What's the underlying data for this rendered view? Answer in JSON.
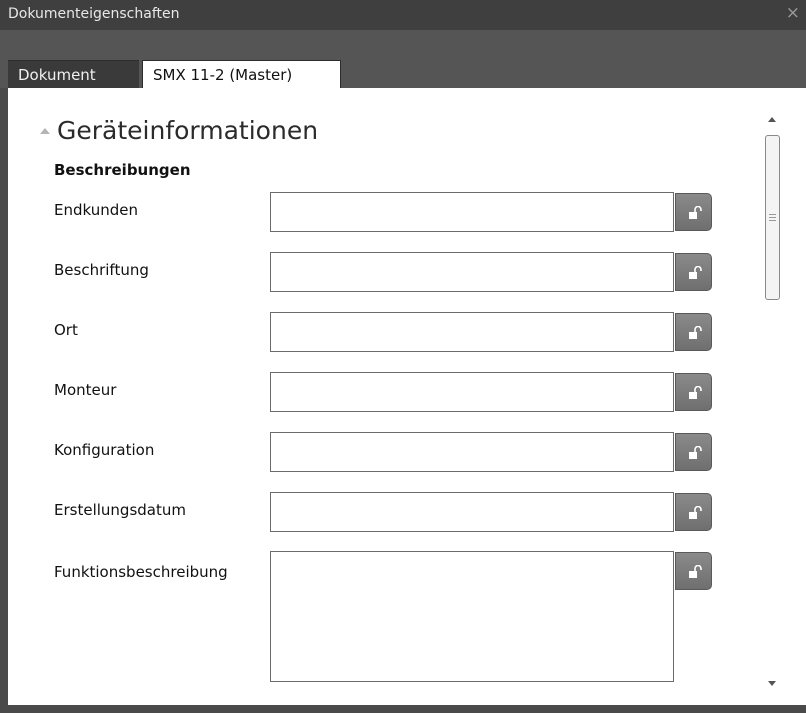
{
  "window": {
    "title": "Dokumenteigenschaften",
    "close_glyph": "×"
  },
  "tabs": [
    {
      "label": "Dokument",
      "active": false
    },
    {
      "label": "SMX 11-2 (Master)",
      "active": true
    }
  ],
  "section": {
    "title": "Geräteinformationen",
    "subheading": "Beschreibungen",
    "fields": [
      {
        "label": "Endkunden",
        "value": ""
      },
      {
        "label": "Beschriftung",
        "value": ""
      },
      {
        "label": "Ort",
        "value": ""
      },
      {
        "label": "Monteur",
        "value": ""
      },
      {
        "label": "Konfiguration",
        "value": ""
      },
      {
        "label": "Erstellungsdatum",
        "value": ""
      },
      {
        "label": "Funktionsbeschreibung",
        "value": ""
      }
    ]
  },
  "icons": {
    "collapse": "triangle-up-icon",
    "lock": "unlocked-padlock-icon",
    "close": "close-icon"
  },
  "colors": {
    "chrome": "#4a4a4a",
    "tab_inactive": "#3a3a3a",
    "lock_button": "#7a7a7a"
  }
}
